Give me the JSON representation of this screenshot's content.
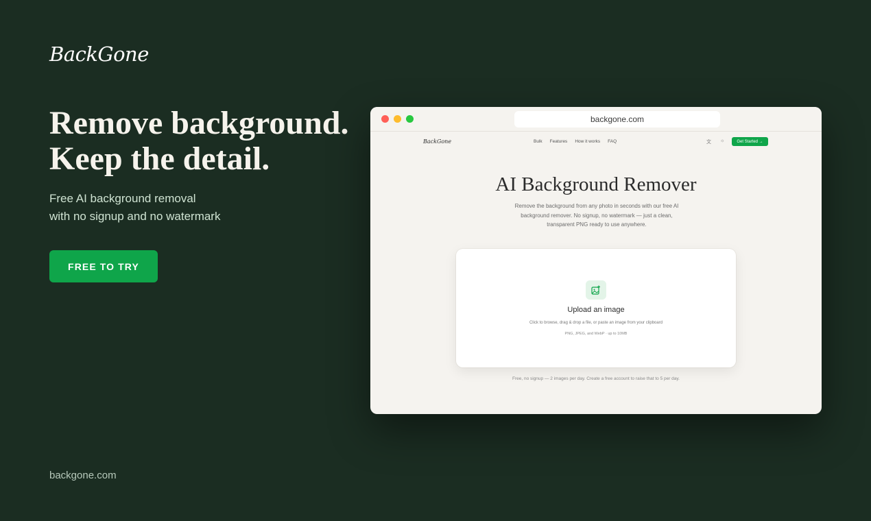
{
  "brand": {
    "logo": "BackGone"
  },
  "hero": {
    "headline_line1": "Remove background.",
    "headline_line2": "Keep the detail.",
    "sub_line1": "Free AI background removal",
    "sub_line2": "with no signup and no watermark",
    "cta_label": "FREE TO TRY"
  },
  "footer": {
    "url": "backgone.com"
  },
  "colors": {
    "background": "#1b2d22",
    "accent": "#0fa54a"
  },
  "browser": {
    "address": "backgone.com",
    "site": {
      "logo": "BackGone",
      "nav": [
        "Bulk",
        "Features",
        "How it works",
        "FAQ"
      ],
      "lang_icon": "translate-icon",
      "theme_icon": "sun-icon",
      "get_started": "Get Started →",
      "title": "AI Background Remover",
      "desc_line1": "Remove the background from any photo in seconds with our free AI",
      "desc_line2": "background remover. No signup, no watermark — just a clean,",
      "desc_line3": "transparent PNG ready to use anywhere.",
      "upload": {
        "icon": "image-plus-icon",
        "title": "Upload an image",
        "desc": "Click to browse, drag & drop a file, or paste an image from your clipboard",
        "formats": "PNG, JPEG, and WebP · up to 10MB"
      },
      "quota": "Free, no signup — 2 images per day. Create a free account to raise that to 5 per day."
    }
  }
}
